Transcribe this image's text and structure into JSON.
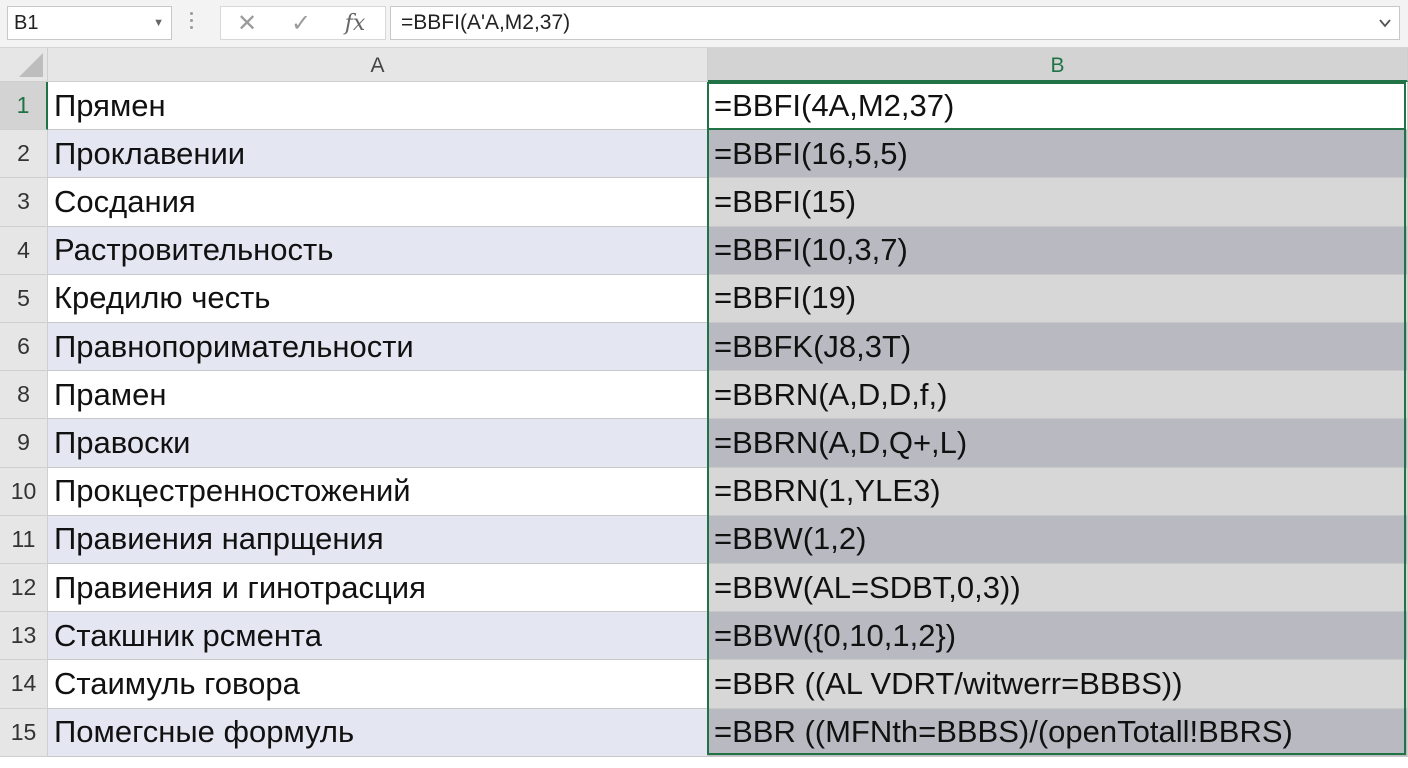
{
  "formula_bar": {
    "name_box": "B1",
    "cancel_glyph": "✕",
    "enter_glyph": "✓",
    "fx_glyph": "fx",
    "formula": "=BBFI(A'A,M2,37)"
  },
  "columns": [
    "A",
    "B"
  ],
  "rows": [
    {
      "num": "1",
      "a": "Прямен",
      "b": "=BBFI(4A,M2,37)"
    },
    {
      "num": "2",
      "a": "Проклавении",
      "b": "=BBFI(16,5,5)"
    },
    {
      "num": "3",
      "a": "Сосдания",
      "b": "=BBFI(15)"
    },
    {
      "num": "4",
      "a": "Растровительность",
      "b": "=BBFI(10,3,7)"
    },
    {
      "num": "5",
      "a": "Кредилю честь",
      "b": "=BBFI(19)"
    },
    {
      "num": "6",
      "a": "Правнопоримательности",
      "b": "=BBFK(J8,3T)"
    },
    {
      "num": "8",
      "a": "Прамен",
      "b": "=BBRN(A,D,D,f,)"
    },
    {
      "num": "9",
      "a": "Правоски",
      "b": "=BBRN(A,D,Q+,L)"
    },
    {
      "num": "10",
      "a": "Прокцестренностожений",
      "b": "=BBRN(1,YLE3)"
    },
    {
      "num": "11",
      "a": "Правиения напрщения",
      "b": "=BBW(1,2)"
    },
    {
      "num": "12",
      "a": "Правиения и гинотрасция",
      "b": "=BBW(AL=SDBT,0,3))"
    },
    {
      "num": "13",
      "a": "Стакшник рсмента",
      "b": "=BBW({0,10,1,2})"
    },
    {
      "num": "14",
      "a": "Стаимуль говора",
      "b": "=BBR ((AL VDRT/witwerr=BBBS))"
    },
    {
      "num": "15",
      "a": "Помегсные формуль",
      "b": "=BBR ((MFNth=BBBS)/(openTotall!BBRS)"
    }
  ],
  "colors": {
    "accent": "#217346",
    "header_bg": "#e6e6e6",
    "band_a": "#e4e6f2",
    "band_b": "#b9b9c1"
  }
}
